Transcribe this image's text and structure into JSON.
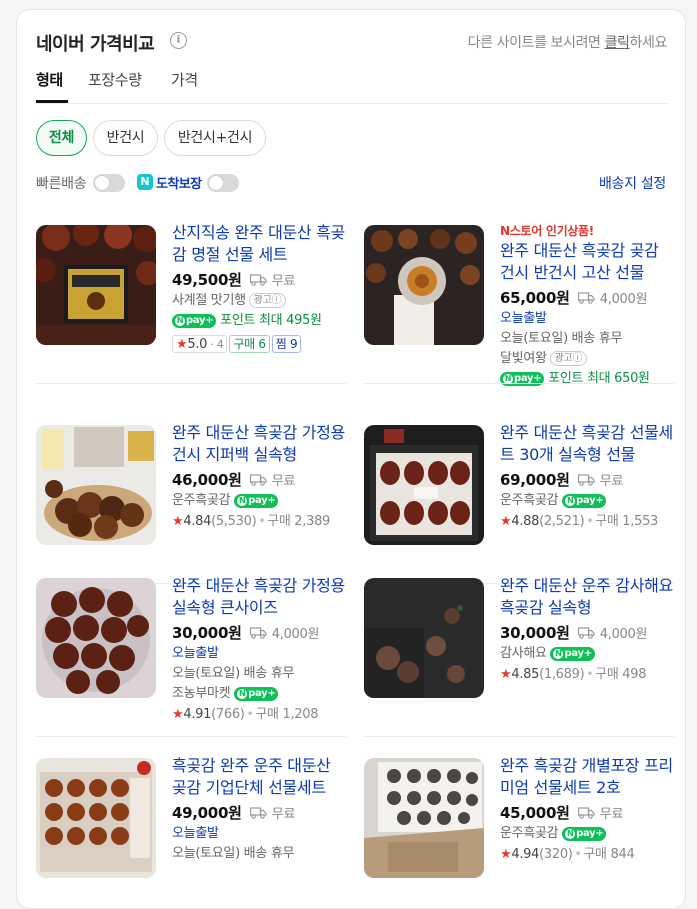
{
  "header": {
    "title": "네이버 가격비교",
    "info_icon": "i",
    "other_site_prefix": "다른 사이트를 보시려면 ",
    "other_site_link": "클릭",
    "other_site_suffix": "하세요"
  },
  "tabs": [
    {
      "label": "형태",
      "active": true
    },
    {
      "label": "포장수량",
      "active": false
    },
    {
      "label": "가격",
      "active": false
    }
  ],
  "chips": [
    {
      "label": "전체",
      "active": true
    },
    {
      "label": "반건시",
      "active": false
    },
    {
      "label": "반건시+건시",
      "active": false
    }
  ],
  "filters": {
    "fast_delivery": "빠른배송",
    "arrival_badge": "N",
    "arrival_guarantee": "도착보장",
    "shipping_setting": "배송지 설정"
  },
  "colors": {
    "brand_green": "#0fbf57",
    "link_blue": "#0d3bb5",
    "badge_red": "#e4342a"
  },
  "products": [
    {
      "name": "산지직송 완주 대둔산 흑곶감 명절 선물 세트",
      "price": "49,500원",
      "shipping": "무료",
      "store": "사계절 맛기행",
      "ad": "광고ⓘ",
      "npay": "pay",
      "points": "포인트 최대 495원",
      "rating": "5.0",
      "rating_sub": "4",
      "purchase_tag": "구매 6",
      "wish_tag": "찜 9"
    },
    {
      "badge": "N스토어 인기상품!",
      "name": "완주 대둔산 흑곶감 곶감 건시 반건시 고산 선물",
      "price": "65,000원",
      "shipping": "4,000원",
      "today": "오늘출발",
      "closed": "오늘(토요일) 배송 휴무",
      "store": "달빛여왕",
      "ad": "광고ⓘ",
      "npay": "pay",
      "points": "포인트 최대 650원"
    },
    {
      "name": "완주 대둔산 흑곶감 가정용 건시 지퍼백 실속형",
      "price": "46,000원",
      "shipping": "무료",
      "store": "운주흑곶감",
      "npay": "pay",
      "rating": "4.84",
      "rating_count": "(5,530)",
      "purchases": "구매 2,389"
    },
    {
      "name": "완주 대둔산 흑곶감 선물세트 30개 실속형 선물",
      "price": "69,000원",
      "shipping": "무료",
      "store": "운주흑곶감",
      "npay": "pay",
      "rating": "4.88",
      "rating_count": "(2,521)",
      "purchases": "구매 1,553"
    },
    {
      "name": "완주 대둔산 흑곶감 가정용 실속형 큰사이즈",
      "price": "30,000원",
      "shipping": "4,000원",
      "today": "오늘출발",
      "closed": "오늘(토요일) 배송 휴무",
      "store": "조농부마켓",
      "npay": "pay",
      "rating": "4.91",
      "rating_count": "(766)",
      "purchases": "구매 1,208"
    },
    {
      "name": "완주 대둔산 운주 감사해요 흑곶감 실속형",
      "price": "30,000원",
      "shipping": "4,000원",
      "store": "감사해요",
      "npay": "pay",
      "rating": "4.85",
      "rating_count": "(1,689)",
      "purchases": "구매 498"
    },
    {
      "name": "흑곶감 완주 운주 대둔산 곶감 기업단체 선물세트",
      "price": "49,000원",
      "shipping": "무료",
      "today": "오늘출발",
      "closed": "오늘(토요일) 배송 휴무"
    },
    {
      "name": "완주 흑곶감 개별포장 프리미엄 선물세트 2호",
      "price": "45,000원",
      "shipping": "무료",
      "store": "운주흑곶감",
      "npay": "pay",
      "rating": "4.94",
      "rating_count": "(320)",
      "purchases": "구매 844"
    }
  ]
}
